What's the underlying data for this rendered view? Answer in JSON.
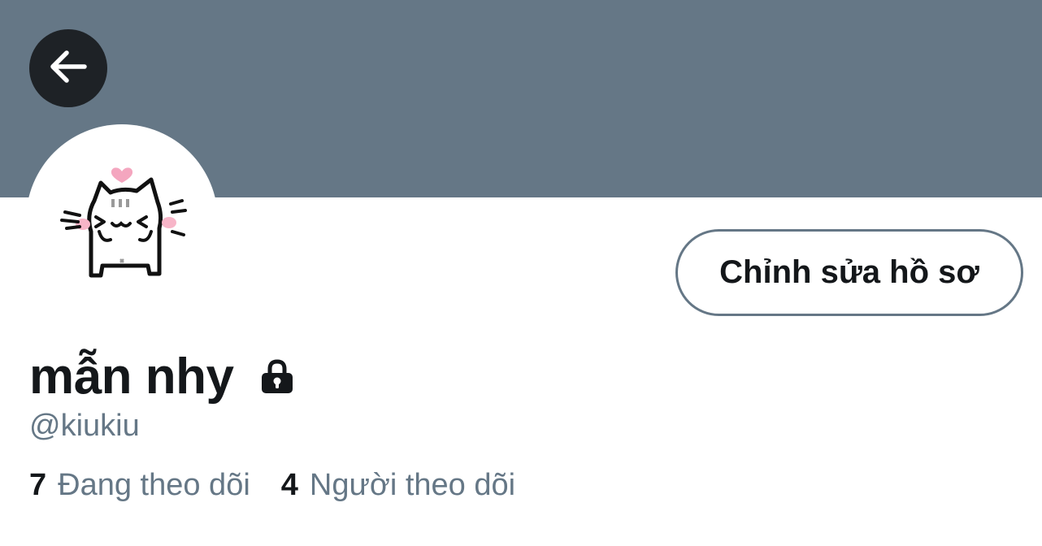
{
  "header": {
    "banner_color": "#657786",
    "back_icon": "arrow-left-icon"
  },
  "profile": {
    "avatar_icon": "cat-avatar-icon",
    "display_name": "mẫn nhy",
    "protected_icon": "lock-icon",
    "handle": "@kiukiu"
  },
  "actions": {
    "edit_profile_label": "Chỉnh sửa hồ sơ"
  },
  "stats": {
    "following_count": "7",
    "following_label": "Đang theo dõi",
    "followers_count": "4",
    "followers_label": "Người theo dõi"
  },
  "colors": {
    "text_primary": "#14171a",
    "text_secondary": "#657786",
    "back_button_bg": "#1e2226",
    "avatar_heart": "#f4a6bf",
    "avatar_blush": "#f7b5c8"
  }
}
